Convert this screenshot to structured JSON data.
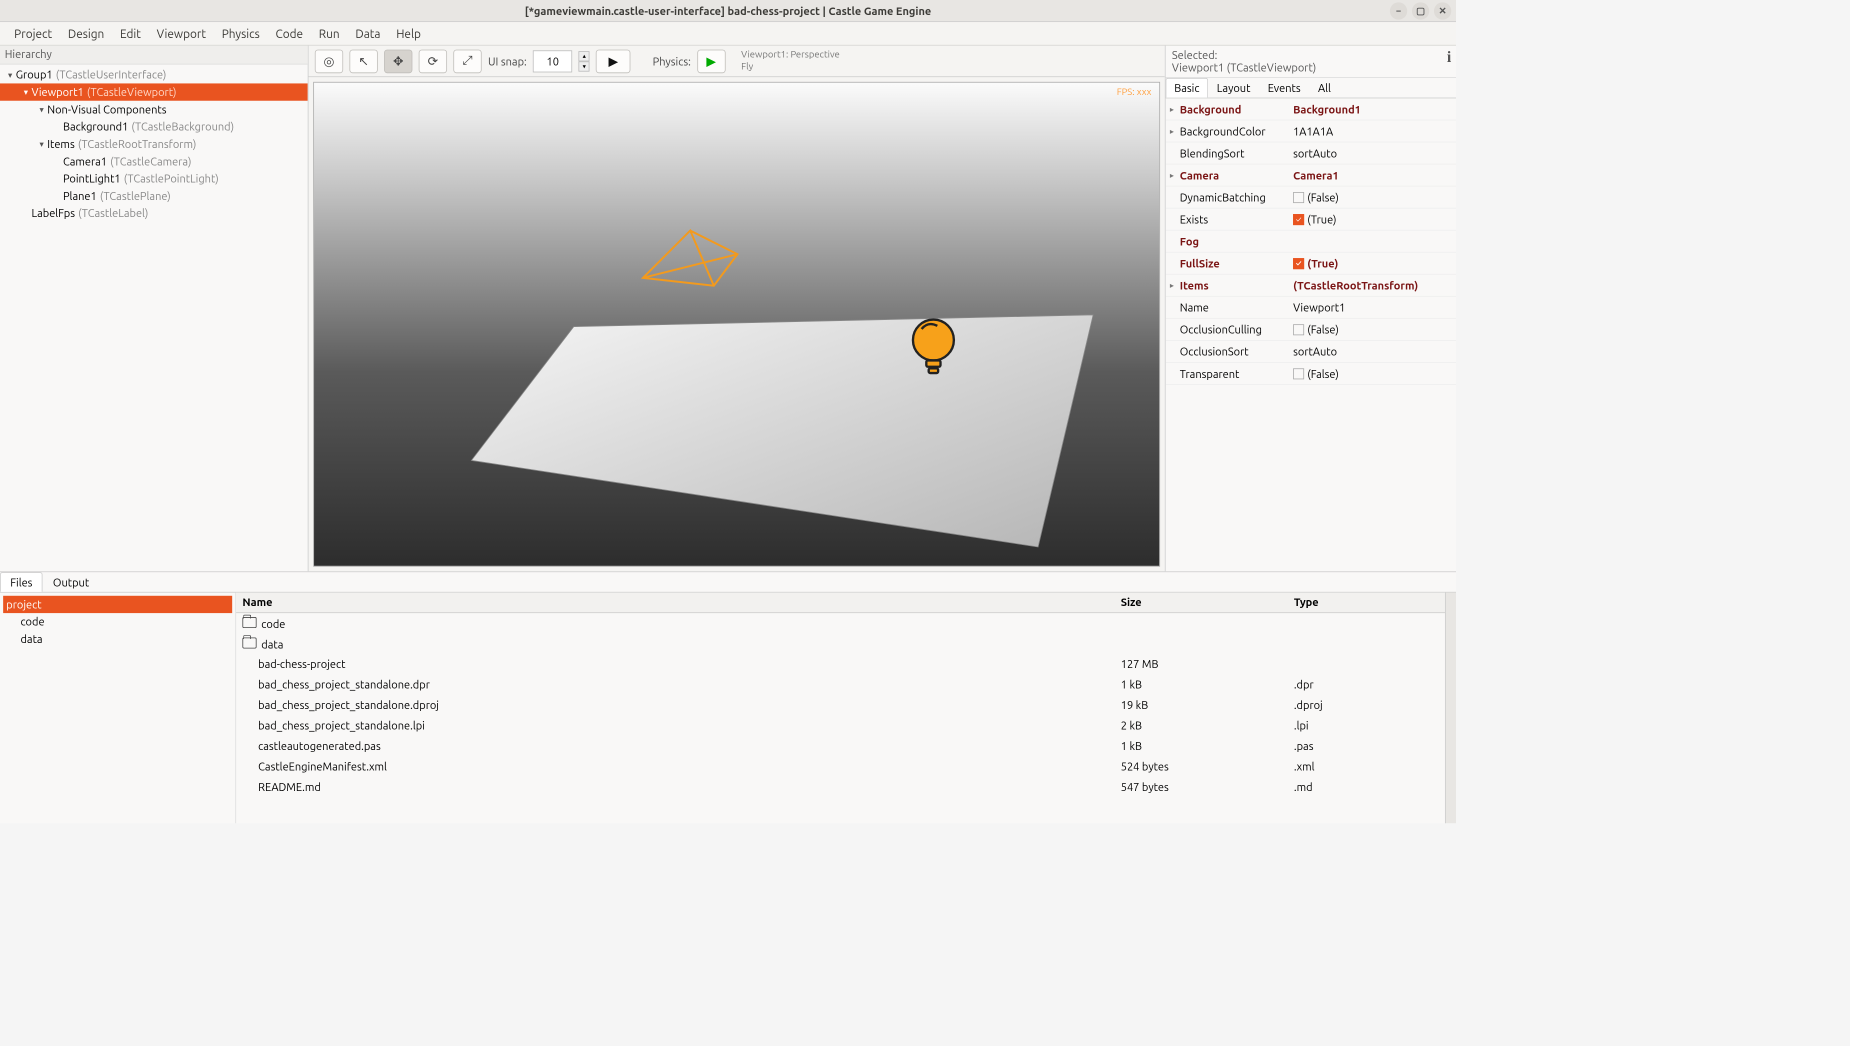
{
  "window": {
    "title": "[*gameviewmain.castle-user-interface] bad-chess-project | Castle Game Engine"
  },
  "menu": {
    "items": [
      "Project",
      "Design",
      "Edit",
      "Viewport",
      "Physics",
      "Code",
      "Run",
      "Data",
      "Help"
    ]
  },
  "hierarchy": {
    "title": "Hierarchy",
    "nodes": [
      {
        "label": "Group1",
        "cls": "(TCastleUserInterface)",
        "indent": 0,
        "arrow": "▾",
        "selected": false
      },
      {
        "label": "Viewport1",
        "cls": "(TCastleViewport)",
        "indent": 1,
        "arrow": "▾",
        "selected": true
      },
      {
        "label": "Non-Visual Components",
        "cls": "",
        "indent": 2,
        "arrow": "▾",
        "selected": false
      },
      {
        "label": "Background1",
        "cls": "(TCastleBackground)",
        "indent": 3,
        "arrow": "",
        "selected": false
      },
      {
        "label": "Items",
        "cls": "(TCastleRootTransform)",
        "indent": 2,
        "arrow": "▾",
        "selected": false
      },
      {
        "label": "Camera1",
        "cls": "(TCastleCamera)",
        "indent": 3,
        "arrow": "",
        "selected": false
      },
      {
        "label": "PointLight1",
        "cls": "(TCastlePointLight)",
        "indent": 3,
        "arrow": "",
        "selected": false
      },
      {
        "label": "Plane1",
        "cls": "(TCastlePlane)",
        "indent": 3,
        "arrow": "",
        "selected": false
      },
      {
        "label": "LabelFps",
        "cls": "(TCastleLabel)",
        "indent": 1,
        "arrow": "",
        "selected": false
      }
    ]
  },
  "toolbar": {
    "snap_label": "UI snap:",
    "snap_value": "10",
    "physics_label": "Physics:",
    "viewport_info_line1": "Viewport1: Perspective",
    "viewport_info_line2": "Fly"
  },
  "viewport": {
    "fps": "FPS: xxx"
  },
  "inspector": {
    "selected_label": "Selected:",
    "selected_name": "Viewport1 (TCastleViewport)",
    "tabs": [
      "Basic",
      "Layout",
      "Events",
      "All"
    ],
    "props": [
      {
        "exp": "▸",
        "name": "Background",
        "value": "Background1",
        "notdefault": true,
        "checkbox": false
      },
      {
        "exp": "▸",
        "name": "BackgroundColor",
        "value": "1A1A1A",
        "notdefault": false,
        "checkbox": false
      },
      {
        "exp": "",
        "name": "BlendingSort",
        "value": "sortAuto",
        "notdefault": false,
        "checkbox": false
      },
      {
        "exp": "▸",
        "name": "Camera",
        "value": "Camera1",
        "notdefault": true,
        "checkbox": false
      },
      {
        "exp": "",
        "name": "DynamicBatching",
        "value": "(False)",
        "notdefault": false,
        "checkbox": true,
        "checked": false
      },
      {
        "exp": "",
        "name": "Exists",
        "value": "(True)",
        "notdefault": false,
        "checkbox": true,
        "checked": true
      },
      {
        "exp": "",
        "name": "Fog",
        "value": "",
        "notdefault": true,
        "checkbox": false
      },
      {
        "exp": "",
        "name": "FullSize",
        "value": "(True)",
        "notdefault": true,
        "checkbox": true,
        "checked": true
      },
      {
        "exp": "▸",
        "name": "Items",
        "value": "(TCastleRootTransform)",
        "notdefault": true,
        "checkbox": false
      },
      {
        "exp": "",
        "name": "Name",
        "value": "Viewport1",
        "notdefault": false,
        "checkbox": false
      },
      {
        "exp": "",
        "name": "OcclusionCulling",
        "value": "(False)",
        "notdefault": false,
        "checkbox": true,
        "checked": false
      },
      {
        "exp": "",
        "name": "OcclusionSort",
        "value": "sortAuto",
        "notdefault": false,
        "checkbox": false
      },
      {
        "exp": "",
        "name": "Transparent",
        "value": "(False)",
        "notdefault": false,
        "checkbox": true,
        "checked": false
      }
    ]
  },
  "bottom": {
    "tabs": [
      "Files",
      "Output"
    ],
    "folder_tree": [
      {
        "label": "project",
        "selected": true,
        "indent": 0
      },
      {
        "label": "code",
        "selected": false,
        "indent": 1
      },
      {
        "label": "data",
        "selected": false,
        "indent": 1
      }
    ],
    "columns": {
      "name": "Name",
      "size": "Size",
      "type": "Type"
    },
    "rows": [
      {
        "name": "code",
        "size": "",
        "type": "",
        "folder": true
      },
      {
        "name": "data",
        "size": "",
        "type": "",
        "folder": true
      },
      {
        "name": "bad-chess-project",
        "size": "127 MB",
        "type": "",
        "folder": false
      },
      {
        "name": "bad_chess_project_standalone.dpr",
        "size": "1 kB",
        "type": ".dpr",
        "folder": false
      },
      {
        "name": "bad_chess_project_standalone.dproj",
        "size": "19 kB",
        "type": ".dproj",
        "folder": false
      },
      {
        "name": "bad_chess_project_standalone.lpi",
        "size": "2 kB",
        "type": ".lpi",
        "folder": false
      },
      {
        "name": "castleautogenerated.pas",
        "size": "1 kB",
        "type": ".pas",
        "folder": false
      },
      {
        "name": "CastleEngineManifest.xml",
        "size": "524 bytes",
        "type": ".xml",
        "folder": false
      },
      {
        "name": "README.md",
        "size": "547 bytes",
        "type": ".md",
        "folder": false
      }
    ]
  }
}
